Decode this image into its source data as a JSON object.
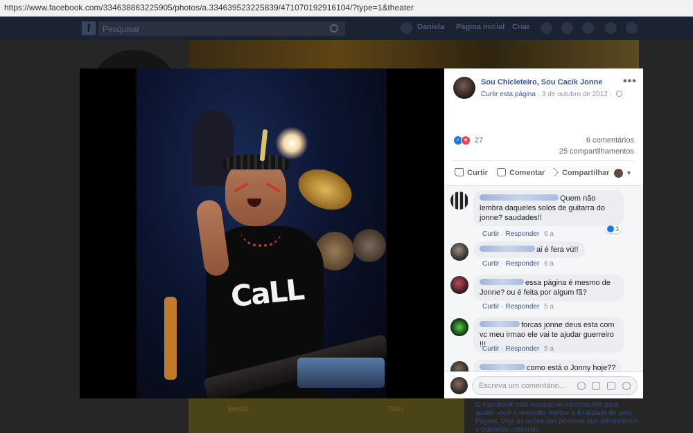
{
  "browser": {
    "url": "https://www.facebook.com/334638863225905/photos/a.334639523225839/471070192916104/?type=1&theater"
  },
  "fb_header": {
    "logo": "f",
    "search_placeholder": "Pesquisar",
    "profile_name": "Daniela",
    "home_label": "Página inicial",
    "create_label": "Criar"
  },
  "background_page": {
    "ad_name_left": "Sergio",
    "ad_name_right": "Tony",
    "sidebar_text": "O Facebook está mostrando informações para ajudar você a entender melhor a finalidade de uma Página. Veja as ações das pessoas que administram e publicam conteúdo."
  },
  "post": {
    "page_name": "Sou Chicleteiro, Sou Cacik Jonne",
    "like_page_label": "Curtir esta página",
    "separator": "·",
    "date": "3 de outubro de 2012",
    "more_options": "•••",
    "reactions_count": "27",
    "comments_count": "6 comentários",
    "shares_count": "25 compartilhamentos",
    "photo_shirt_text": "CaLL"
  },
  "actions": {
    "like": "Curtir",
    "comment": "Comentar",
    "share": "Compartilhar"
  },
  "comment_actions": {
    "like": "Curtir",
    "reply": "Responder"
  },
  "comments": [
    {
      "text": "Quem não lembra daqueles solos de guitarra do jonne? saudades!!",
      "age": "6 a",
      "reactions": "3"
    },
    {
      "text": "ai é fera vú!!",
      "age": "6 a"
    },
    {
      "text": "essa página é mesmo de Jonne? ou é feita por algum fã?",
      "age": "5 a"
    },
    {
      "text": "forcas jonne deus esta com vc meu irmao ele vai te ajudar guerreiro !!!",
      "age": "5 a"
    },
    {
      "text": "como está o Jonny hoje??"
    }
  ],
  "composer": {
    "placeholder": "Escreva um comentário..."
  },
  "colors": {
    "link_blue": "#385898",
    "like_blue": "#1877f2",
    "love_red": "#f33e58",
    "meta_gray": "#90949c"
  },
  "icons": [
    "globe-icon",
    "like-reaction-icon",
    "love-reaction-icon",
    "like-icon",
    "comment-icon",
    "share-icon",
    "emoji-icon",
    "camera-icon",
    "gif-icon",
    "sticker-icon",
    "search-icon"
  ]
}
